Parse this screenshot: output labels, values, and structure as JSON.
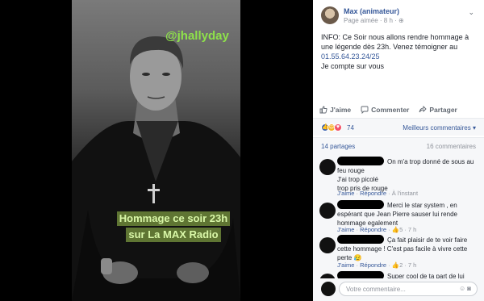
{
  "media": {
    "handle": "@jhallyday",
    "overlay_line1": "Hommage ce soir 23h",
    "overlay_line2": "sur La MAX Radio"
  },
  "post": {
    "author": "Max (animateur)",
    "meta": "Page aimée · 8 h · ",
    "line1": "INFO: Ce Soir nous allons rendre hommage à une légende dès 23h. Venez témoigner au",
    "phone": "01.55.64.23.24/25",
    "line2": "Je compte sur vous"
  },
  "actions": {
    "like": "J'aime",
    "comment": "Commenter",
    "share": "Partager"
  },
  "reactions": {
    "count": "74",
    "sort_label": "Meilleurs commentaires"
  },
  "stats": {
    "shares": "14 partages",
    "comments": "16 commentaires"
  },
  "comments": [
    {
      "text": "On m'a trop donné de sous au feu rouge\nJ'ai trop picolé\ntrop pris de rouge",
      "like": "J'aime",
      "reply": "Répondre",
      "time": " · À l'instant",
      "reactions": ""
    },
    {
      "text": "Merci le star system , en espérant que Jean Pierre sauser lui rende hommage egalement",
      "like": "J'aime",
      "reply": "Répondre",
      "time": " · 7 h",
      "reactions": "5"
    },
    {
      "text": "Ça fait plaisir de te voir faire cette hommage ! C'est pas facile à vivre cette perte 😥",
      "like": "J'aime",
      "reply": "Répondre",
      "time": " · 7 h",
      "reactions": "2"
    },
    {
      "text": "Super cool de ta part de lui rendre",
      "like": "",
      "reply": "",
      "time": "",
      "reactions": ""
    }
  ],
  "input": {
    "placeholder": "Votre commentaire..."
  },
  "colors": {
    "link": "#365899",
    "muted": "#90949c",
    "accent_green": "#8ee24a"
  }
}
